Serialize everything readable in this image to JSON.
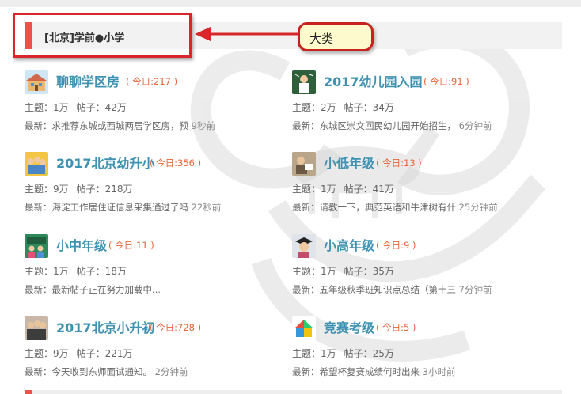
{
  "category": {
    "title": "[北京]学前●小学"
  },
  "annotation": {
    "bubble_text": "大类",
    "stroke_color": "#d9262a",
    "fill_color": "#fdfbce"
  },
  "colors": {
    "accent": "#e8534a",
    "forum_name": "#3f92b1",
    "today": "#e8653a"
  },
  "forums": [
    {
      "name": "聊聊学区房",
      "today": "( 今日:217 )",
      "topics": "主题：1万",
      "posts": "帖子：42万",
      "latest": "最新：求推荐东城或西城两居学区房，预",
      "time": "9秒前",
      "icon": "school-building-icon"
    },
    {
      "name": "2017幼儿园入园",
      "today": "( 今日:91 )",
      "topics": "主题：2万",
      "posts": "帖子：34万",
      "latest": "最新：东城区崇文回民幼儿园开始招生，",
      "time": "6分钟前",
      "icon": "child-blackboard-icon"
    },
    {
      "name": "2017北京幼升小",
      "today": "( 今日:356 )",
      "topics": "主题：9万",
      "posts": "帖子：218万",
      "latest": "最新：海淀工作居住证信息采集通过了吗",
      "time": "22秒前",
      "icon": "kids-group-icon"
    },
    {
      "name": "小低年级",
      "today": "( 今日:13 )",
      "topics": "主题：1万",
      "posts": "帖子：41万",
      "latest": "最新：请教一下，典范英语和牛津树有什",
      "time": "25分钟前",
      "icon": "kids-reading-icon"
    },
    {
      "name": "小中年级",
      "today": "( 今日:11 )",
      "topics": "主题：1万",
      "posts": "帖子：18万",
      "latest": "最新：最新帖子正在努力加载中...",
      "time": "",
      "icon": "classroom-icon"
    },
    {
      "name": "小高年级",
      "today": "( 今日:9 )",
      "topics": "主题：1万",
      "posts": "帖子：35万",
      "latest": "最新：五年级秋季班知识点总结（第十三",
      "time": "7分钟前",
      "icon": "graduate-girl-icon"
    },
    {
      "name": "2017北京小升初",
      "today": "( 今日:728 )",
      "topics": "主题：9万",
      "posts": "帖子：221万",
      "latest": "最新：今天收到东师面试通知。",
      "time": "2分钟前",
      "icon": "students-group-icon"
    },
    {
      "name": "竞赛考级",
      "today": "( 今日:5 )",
      "topics": "主题：1万",
      "posts": "帖子：25万",
      "latest": "最新：希望杯复赛成绩何时出来",
      "time": "3小时前",
      "icon": "colorful-house-icon"
    }
  ]
}
